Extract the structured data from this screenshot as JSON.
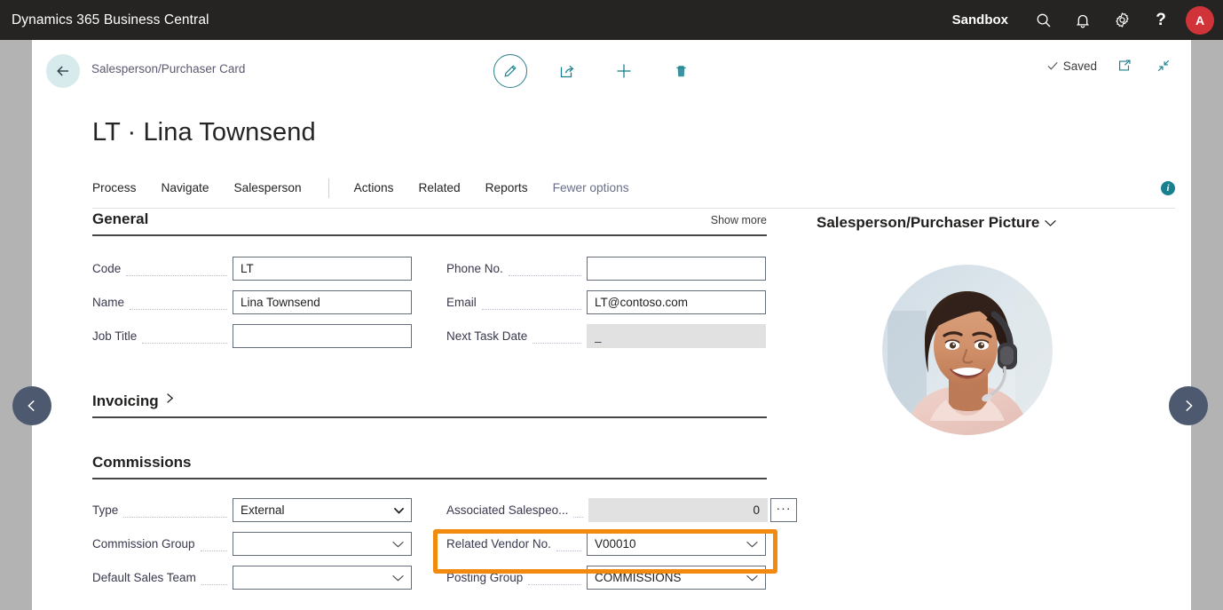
{
  "topbar": {
    "app_title": "Dynamics 365 Business Central",
    "environment": "Sandbox",
    "search_icon": "search-icon",
    "notifications_icon": "bell-icon",
    "settings_icon": "gear-icon",
    "help_label": "?",
    "avatar_initial": "A"
  },
  "commandbar": {
    "back_icon": "back-arrow-icon",
    "breadcrumb": "Salesperson/Purchaser Card",
    "edit_icon": "pencil-icon",
    "share_icon": "share-icon",
    "new_icon": "plus-icon",
    "delete_icon": "trash-icon",
    "saved_label": "Saved",
    "open_new_window_icon": "open-in-new-window-icon",
    "collapse_icon": "collapse-icon"
  },
  "page": {
    "title": "LT · Lina Townsend"
  },
  "menubar": {
    "items": [
      {
        "label": "Process",
        "muted": false
      },
      {
        "label": "Navigate",
        "muted": false
      },
      {
        "label": "Salesperson",
        "muted": false
      },
      {
        "label": "Actions",
        "muted": false
      },
      {
        "label": "Related",
        "muted": false
      },
      {
        "label": "Reports",
        "muted": false
      },
      {
        "label": "Fewer options",
        "muted": true
      }
    ],
    "info_badge": "i"
  },
  "general": {
    "heading": "General",
    "show_more": "Show more",
    "fields": {
      "code": {
        "label": "Code",
        "value": "LT"
      },
      "name": {
        "label": "Name",
        "value": "Lina Townsend"
      },
      "job_title": {
        "label": "Job Title",
        "value": ""
      },
      "phone_no": {
        "label": "Phone No.",
        "value": ""
      },
      "email": {
        "label": "Email",
        "value": "LT@contoso.com"
      },
      "next_task_date": {
        "label": "Next Task Date",
        "value": "_"
      }
    }
  },
  "invoicing": {
    "heading": "Invoicing"
  },
  "commissions": {
    "heading": "Commissions",
    "fields": {
      "type": {
        "label": "Type",
        "value": "External"
      },
      "commission_group": {
        "label": "Commission Group",
        "value": ""
      },
      "default_sales_team": {
        "label": "Default Sales Team",
        "value": ""
      },
      "associated_salespeople": {
        "label": "Associated Salespeo...",
        "value": "0",
        "lookup_label": "···"
      },
      "related_vendor_no": {
        "label": "Related Vendor No.",
        "value": "V00010"
      },
      "posting_group": {
        "label": "Posting Group",
        "value": "COMMISSIONS"
      }
    },
    "highlight_color": "#f28a0f",
    "highlighted_field": "posting_group"
  },
  "picture_part": {
    "heading": "Salesperson/Purchaser Picture",
    "collapse_icon": "chevron-down-icon",
    "photo_alt": "salesperson-photo"
  },
  "navigation": {
    "previous_icon": "chevron-left-icon",
    "next_icon": "chevron-right-icon"
  },
  "colors": {
    "topbar_bg": "#252423",
    "accent_teal": "#17818f",
    "avatar_red": "#d13438",
    "highlight_orange": "#f28a0f",
    "backdrop_gray": "#b3b3b3",
    "nav_circle": "#4d596e"
  }
}
